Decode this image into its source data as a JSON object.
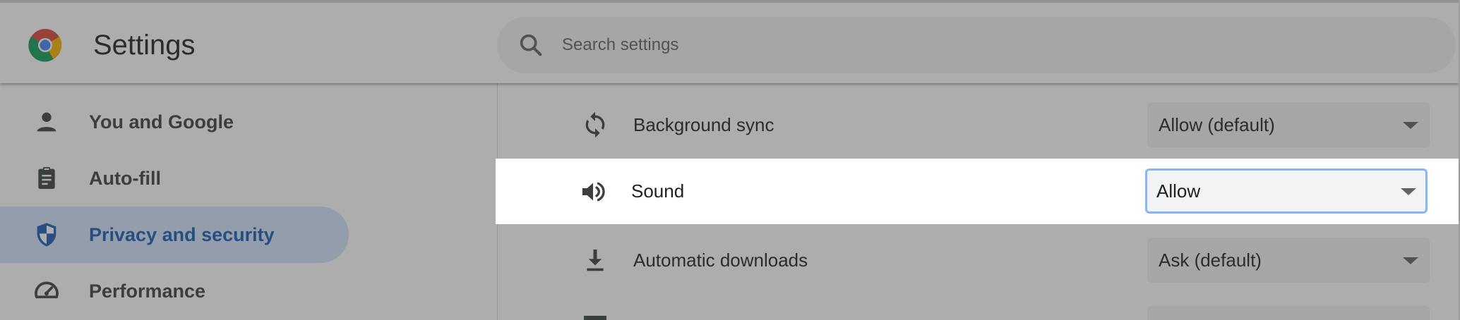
{
  "header": {
    "title": "Settings",
    "logo_icon": "chrome-logo-icon",
    "search": {
      "placeholder": "Search settings",
      "value": "",
      "icon": "search-icon"
    }
  },
  "sidebar": {
    "items": [
      {
        "label": "You and Google",
        "icon": "person-icon",
        "active": false
      },
      {
        "label": "Auto-fill",
        "icon": "clipboard-icon",
        "active": false
      },
      {
        "label": "Privacy and security",
        "icon": "shield-icon",
        "active": true
      },
      {
        "label": "Performance",
        "icon": "speedometer-icon",
        "active": false
      }
    ]
  },
  "permissions": {
    "rows": [
      {
        "label": "Background sync",
        "icon": "sync-icon",
        "value": "Allow (default)"
      },
      {
        "label": "Sound",
        "icon": "speaker-icon",
        "value": "Allow",
        "highlighted": true
      },
      {
        "label": "Automatic downloads",
        "icon": "download-icon",
        "value": "Ask (default)"
      }
    ]
  },
  "colors": {
    "active_nav_bg": "#d3e3fd",
    "active_nav_text": "#1a5cb4",
    "focus_ring": "#8ab4f8",
    "dim_overlay": "rgba(60,60,60,0.42)"
  }
}
